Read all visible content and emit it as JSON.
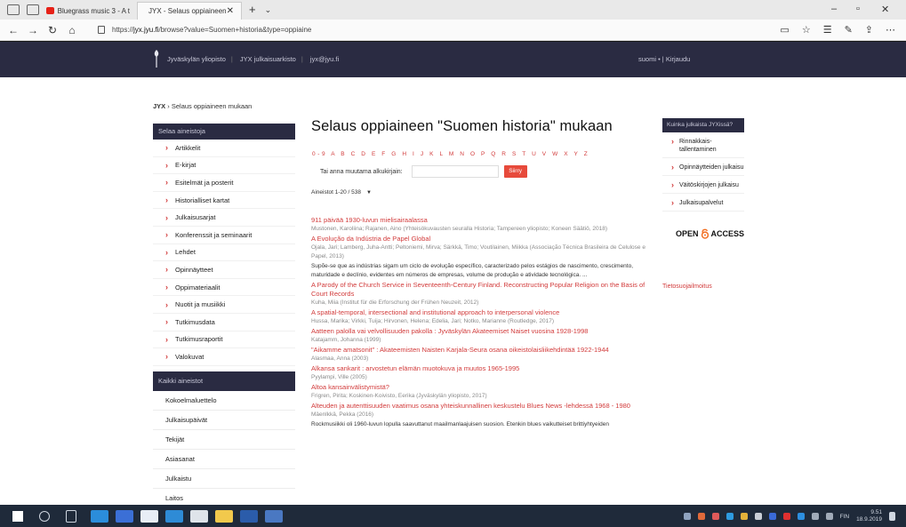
{
  "browser": {
    "tabs": [
      {
        "label": "Bluegrass music 3 - A t",
        "active": false
      },
      {
        "label": "JYX - Selaus oppiaineen",
        "active": true
      }
    ],
    "url_prefix": "https://",
    "url_host": "jyx.jyu.fi",
    "url_path": "/browse?value=Suomen+historia&type=oppiaine"
  },
  "header": {
    "links": [
      "Jyväskylän yliopisto",
      "JYX julkaisuarkisto",
      "jyx@jyu.fi"
    ],
    "language": "suomi • | Kirjaudu"
  },
  "breadcrumb": {
    "home": "JYX",
    "current": "Selaus oppiaineen mukaan"
  },
  "sidebar": {
    "browse_heading": "Selaa aineistoja",
    "items": [
      "Artikkelit",
      "E-kirjat",
      "Esitelmät ja posterit",
      "Historialliset kartat",
      "Julkaisusarjat",
      "Konferenssit ja seminaarit",
      "Lehdet",
      "Opinnäytteet",
      "Oppimateriaalit",
      "Nuotit ja musiikki",
      "Tutkimusdata",
      "Tutkimusraportit",
      "Valokuvat"
    ],
    "all_heading": "Kaikki aineistot",
    "all_items": [
      "Kokoelmaluettelo",
      "Julkaisupäivät",
      "Tekijät",
      "Asiasanat",
      "Julkaistu",
      "Laitos"
    ]
  },
  "main": {
    "title": "Selaus oppiaineen \"Suomen historia\" mukaan",
    "alphabet": "0-9 A B C D E F G H I J K L M N O P Q R S T U V W X Y Z",
    "search_label": "Tai anna muutama alkukirjain:",
    "search_button": "Siirry",
    "count": "Aineistot 1-20 / 538"
  },
  "results": [
    {
      "title": "911 päivää 1930-luvun mielisairaalassa",
      "meta": "Mustonen, Karoliina; Rajanen, Aino (Yhteisökuvausten seuralla Historia; Tampereen yliopisto; Koneen Säätiö, 2018)"
    },
    {
      "title": "A Evolução da Indústria de Papel Global",
      "meta": "Ojala, Jari; Lamberg, Juha-Antti; Peltoniemi, Mirva; Särkkä, Timo; Voutilainen, Miikka (Associação Técnica Brasileira de Celulose e Papel, 2013)",
      "desc": "Supõe-se que as indústrias sigam um ciclo de evolução específico, caracterizado pelos estágios de nascimento, crescimento, maturidade e declínio, evidentes em números de empresas, volume de produção e atividade tecnológica. ..."
    },
    {
      "title": "A Parody of the Church Service in Seventeenth-Century Finland. Reconstructing Popular Religion on the Basis of Court Records",
      "meta": "Kuha, Miia (Institut für die Erforschung der Frühen Neuzeit, 2012)"
    },
    {
      "title": "A spatial-temporal, intersectional and institutional approach to interpersonal violence",
      "meta": "Hussa, Marika; Virkki, Tuija; Hirvonen, Helena; Edelia, Jari; Notko, Marianne (Routledge, 2017)"
    },
    {
      "title": "Aatteen palolla vai velvollisuuden pakolla : Jyväskylän Akateemiset Naiset vuosina 1928-1998",
      "meta": "Katajamm, Johanna (1999)"
    },
    {
      "title": "\"Aikamme amatsonit\" : Akateemisten Naisten Karjala-Seura osana oikeistolaisliikehdintää 1922-1944",
      "meta": "Alasmaa, Anna (2003)"
    },
    {
      "title": "Alkansa sankarit : arvostetun elämän muotokuva ja muutos 1965-1995",
      "meta": "Pyylampi, Ville (2005)"
    },
    {
      "title": "Altoa kansainvälistymistä?",
      "meta": "Frigren, Pirita; Koskinen-Koivisto, Eerika (Jyväskylän yliopisto, 2017)"
    },
    {
      "title": "Alteuden ja autenttisuuden vaatimus osana yhteiskunnallinen keskustelu Blues News -lehdessä 1968 - 1980",
      "meta": "Mäenlkkä, Pekka (2016)",
      "desc": "Rockmusiikki oli 1960-luvun lopulla saavuttanut maailmanlaajuisen suosion. Etenkin blues vaikutteiset brittiyhtyeiden"
    }
  ],
  "rightbox": {
    "heading": "Kuinka julkaista JYXissä?",
    "items": [
      "Rinnakkais-tallentaminen",
      "Opinnäytteiden julkaisu",
      "Väitöskirjojen julkaisu",
      "Julkaisupalvelut"
    ],
    "oa_left": "OPEN",
    "oa_right": "ACCESS",
    "privacy": "Tietosuojailmoitus"
  },
  "taskbar": {
    "lang": "FIN",
    "time": "9.51",
    "date": "18.9.2019"
  },
  "colors": {
    "header": "#2a2b42",
    "accent": "#d23b3b",
    "button": "#e74a3b"
  }
}
